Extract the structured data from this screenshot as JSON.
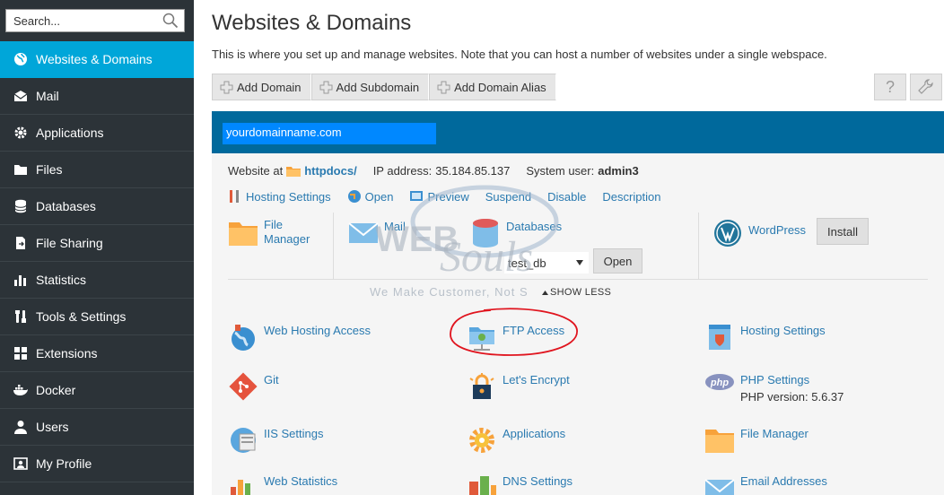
{
  "search": {
    "placeholder": "Search..."
  },
  "sidebar": {
    "items": [
      {
        "label": "Websites & Domains",
        "icon": "globe-icon",
        "active": true
      },
      {
        "label": "Mail",
        "icon": "mail-icon"
      },
      {
        "label": "Applications",
        "icon": "gear-icon"
      },
      {
        "label": "Files",
        "icon": "files-icon"
      },
      {
        "label": "Databases",
        "icon": "database-icon"
      },
      {
        "label": "File Sharing",
        "icon": "file-sharing-icon"
      },
      {
        "label": "Statistics",
        "icon": "bar-chart-icon"
      },
      {
        "label": "Tools & Settings",
        "icon": "tools-icon"
      },
      {
        "label": "Extensions",
        "icon": "grid-icon"
      },
      {
        "label": "Docker",
        "icon": "docker-icon"
      },
      {
        "label": "Users",
        "icon": "user-icon"
      },
      {
        "label": "My Profile",
        "icon": "profile-icon"
      }
    ]
  },
  "page": {
    "title": "Websites & Domains",
    "description": "This is where you set up and manage websites. Note that you can host a number of websites under a single webspace."
  },
  "toolbar": {
    "add_domain": "Add Domain",
    "add_subdomain": "Add Subdomain",
    "add_domain_alias": "Add Domain Alias",
    "help": "?"
  },
  "domain": {
    "name": "yourdomainname.com",
    "website_at_label": "Website at",
    "docroot": "httpdocs/",
    "ip_label": "IP address:",
    "ip": "35.184.85.137",
    "user_label": "System user:",
    "user": "admin3"
  },
  "actions": [
    "Hosting Settings",
    "Open",
    "Preview",
    "Suspend",
    "Disable",
    "Description"
  ],
  "cards": {
    "file_manager_line1": "File",
    "file_manager_line2": "Manager",
    "mail": "Mail",
    "databases": "Databases",
    "db_selected": "test_db",
    "open_button": "Open",
    "wordpress": "WordPress",
    "install_button": "Install"
  },
  "show_less": "SHOW LESS",
  "tools": {
    "web_hosting_access": "Web Hosting Access",
    "ftp_access": "FTP Access",
    "hosting_settings": "Hosting Settings",
    "git": "Git",
    "lets_encrypt": "Let's Encrypt",
    "php_settings": "PHP Settings",
    "php_version": "PHP version: 5.6.37",
    "iis_settings": "IIS Settings",
    "applications": "Applications",
    "file_manager": "File Manager",
    "web_statistics": "Web Statistics",
    "dns_settings": "DNS Settings",
    "email_addresses": "Email Addresses"
  },
  "watermark": {
    "line1": "WEB",
    "line2": "Souls",
    "tagline": "We Make Customer, Not S"
  },
  "colors": {
    "sidebar": "#2c3338",
    "active": "#00a6d9",
    "domain_bar": "#00699c",
    "link": "#2a7ab0",
    "annotation": "#e0141e"
  }
}
